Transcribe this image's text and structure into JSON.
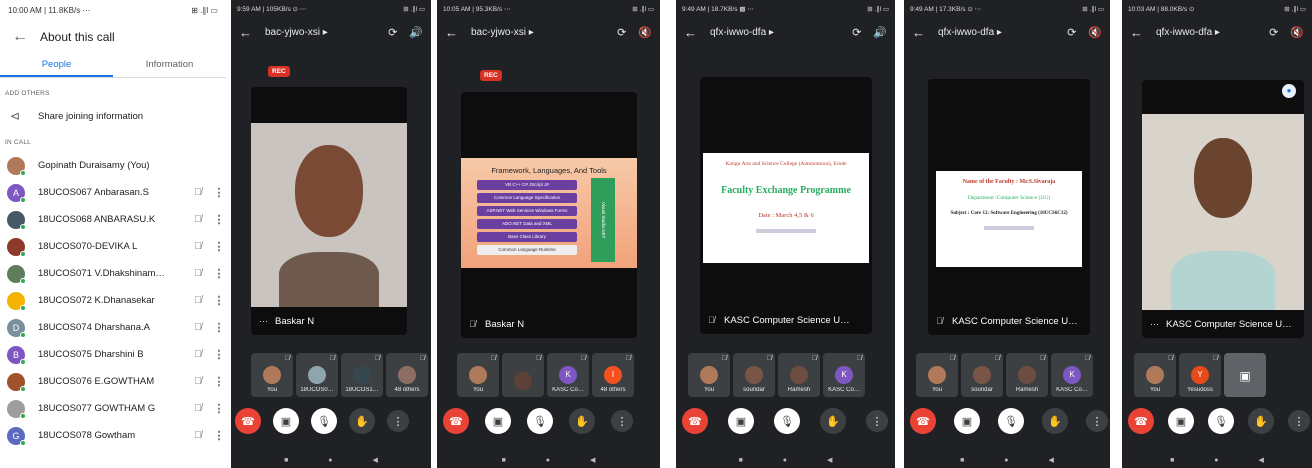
{
  "about": {
    "status_time": "10:00 AM | 11.8KB/s ⋯",
    "status_right": "⊞ .∥l ▭",
    "title": "About this call",
    "tabs": [
      "People",
      "Information"
    ],
    "add_others_label": "ADD OTHERS",
    "share_label": "Share joining information",
    "in_call_label": "IN CALL",
    "people": [
      {
        "name": "Gopinath Duraisamy (You)",
        "avatar": "",
        "color": "#b07a5a",
        "muted": false
      },
      {
        "name": "18UCOS067 Anbarasan.S",
        "avatar": "A",
        "color": "#7e57c2",
        "muted": true
      },
      {
        "name": "18UCOS068 ANBARASU.K",
        "avatar": "",
        "color": "#455a64",
        "muted": true
      },
      {
        "name": "18UCOS070-DEVIKA L",
        "avatar": "",
        "color": "#8d3a2a",
        "muted": true
      },
      {
        "name": "18UCOS071 V.Dhakshinam…",
        "avatar": "",
        "color": "#607d5b",
        "muted": true
      },
      {
        "name": "18UCOS072 K.Dhanasekar",
        "avatar": "",
        "color": "#f4b400",
        "muted": true
      },
      {
        "name": "18UCOS074 Dharshana.A",
        "avatar": "D",
        "color": "#78909c",
        "muted": true
      },
      {
        "name": "18UCOS075 Dharshini B",
        "avatar": "B",
        "color": "#7e57c2",
        "muted": true
      },
      {
        "name": "18UCOS076 E.GOWTHAM",
        "avatar": "",
        "color": "#a0522d",
        "muted": true
      },
      {
        "name": "18UCOS077 GOWTHAM G",
        "avatar": "",
        "color": "#9e9e9e",
        "muted": true
      },
      {
        "name": "18UCOS078 Gowtham",
        "avatar": "G",
        "color": "#5c6bc0",
        "muted": true
      }
    ]
  },
  "phones": [
    {
      "status_time": "9:59 AM | 105KB/s ⊙ ⋯",
      "status_right": "⊞ .∥l ▭",
      "code": "bac-yjwo-xsi ▸",
      "rec": "REC",
      "main_label": "Baskar N",
      "thumbs": [
        {
          "label": "You",
          "avatar": "",
          "color": "#b07a5a"
        },
        {
          "label": "18UCOS0…",
          "avatar": "",
          "color": "#90a4ae"
        },
        {
          "label": "18UCOS1…",
          "avatar": "",
          "color": "#37474f"
        },
        {
          "label": "48 others",
          "avatar": "",
          "color": "#8d6e63"
        }
      ]
    },
    {
      "status_time": "10:05 AM | 95.3KB/s ⋯",
      "status_right": "⊞ .∥l ▭",
      "code": "bac-yjwo-xsi ▸",
      "rec": "REC",
      "main_label": "Baskar N",
      "slide": {
        "title": "Framework, Languages, And Tools",
        "rows": [
          "VB  C++  C#  JScript  J#",
          "Common Language Specification",
          "ASP.NET Web Services  Windows Forms",
          "ADO.NET Data and XML",
          "Base Class Library",
          "Common Language Runtime"
        ],
        "side": "Visual Studio.NET"
      },
      "thumbs": [
        {
          "label": "You",
          "avatar": "",
          "color": "#b07a5a"
        },
        {
          "label": "",
          "avatar": "",
          "color": "#5d4037"
        },
        {
          "label": "KASC Co…",
          "avatar": "K",
          "color": "#7e57c2"
        },
        {
          "label": "48 others",
          "avatar": "I",
          "color": "#f4511e"
        }
      ]
    },
    {
      "status_time": "9:49 AM | 18.7KB/s ▩ ⋯",
      "status_right": "⊞ .∥l ▭",
      "code": "qfx-iwwo-dfa ▸",
      "main_label": "KASC Computer Science U…",
      "slide": {
        "l1": "Kongu Arts and Science College (Autonomous), Erode",
        "l2": "Faculty Exchange Programme",
        "l3": "Date : March 4,5 & 6"
      },
      "thumbs": [
        {
          "label": "You",
          "avatar": "",
          "color": "#b07a5a"
        },
        {
          "label": "soundar",
          "avatar": "",
          "color": "#795548"
        },
        {
          "label": "Ramesh",
          "avatar": "",
          "color": "#6d4c41"
        },
        {
          "label": "KASC Co…",
          "avatar": "K",
          "color": "#7e57c2"
        }
      ]
    },
    {
      "status_time": "9:49 AM | 17.3KB/s ⊙ ⋯",
      "status_right": "⊞ .∥l ▭",
      "code": "qfx-iwwo-dfa ▸",
      "main_label": "KASC Computer Science U…",
      "slide": {
        "l1": "Name of the Faculty : Mr.S.Sivaraja",
        "l2": "Department :Computer Science (UG)",
        "l3": "Subject : Core 12: Software Engineering (16UCS6C12)"
      },
      "thumbs": [
        {
          "label": "You",
          "avatar": "",
          "color": "#b07a5a"
        },
        {
          "label": "soundar",
          "avatar": "",
          "color": "#795548"
        },
        {
          "label": "Ramesh",
          "avatar": "",
          "color": "#6d4c41"
        },
        {
          "label": "KASC Co…",
          "avatar": "K",
          "color": "#7e57c2"
        }
      ]
    },
    {
      "status_time": "10:03 AM | 88.0KB/s ⊙",
      "status_right": "⊞ .∥l ▭",
      "code": "qfx-iwwo-dfa ▸",
      "main_label": "KASC Computer Science U…",
      "thumbs": [
        {
          "label": "You",
          "avatar": "",
          "color": "#b07a5a"
        },
        {
          "label": "Yesudoss",
          "avatar": "Y",
          "color": "#e64a19"
        }
      ]
    }
  ]
}
